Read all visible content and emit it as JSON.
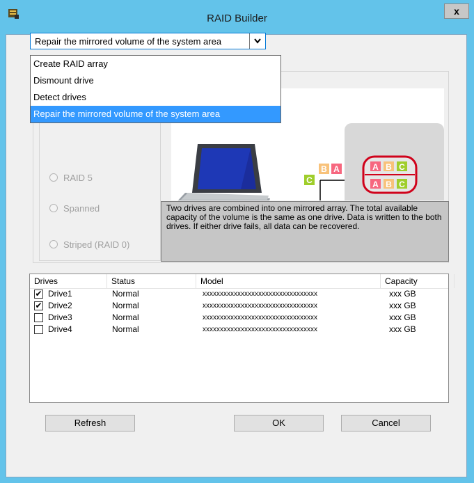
{
  "window": {
    "title": "RAID Builder",
    "close_label": "x",
    "icon": "raid-builder-app-icon"
  },
  "combo": {
    "selected": "Repair the mirrored volume of the system area",
    "options": [
      "Create RAID array",
      "Dismount drive",
      "Detect drives",
      "Repair the mirrored volume of the system area"
    ]
  },
  "raid_types": [
    "RAID 5",
    "Spanned",
    "Striped (RAID 0)"
  ],
  "illustration": {
    "blocks_left": [
      "B",
      "A",
      "C"
    ],
    "disk_blocks": [
      "A",
      "B",
      "C"
    ]
  },
  "description": "Two drives are combined into one mirrored array. The total available capacity of the volume is the same as one drive. Data is written to the both drives. If either drive fails, all data can be recovered.",
  "drives_table": {
    "headers": [
      "Drives",
      "Status",
      "Model",
      "Capacity"
    ],
    "rows": [
      {
        "checked": true,
        "name": "Drive1",
        "status": "Normal",
        "model": "xxxxxxxxxxxxxxxxxxxxxxxxxxxxxxxxx",
        "capacity": "xxx GB"
      },
      {
        "checked": true,
        "name": "Drive2",
        "status": "Normal",
        "model": "xxxxxxxxxxxxxxxxxxxxxxxxxxxxxxxxx",
        "capacity": "xxx GB"
      },
      {
        "checked": false,
        "name": "Drive3",
        "status": "Normal",
        "model": "xxxxxxxxxxxxxxxxxxxxxxxxxxxxxxxxx",
        "capacity": "xxx GB"
      },
      {
        "checked": false,
        "name": "Drive4",
        "status": "Normal",
        "model": "xxxxxxxxxxxxxxxxxxxxxxxxxxxxxxxxx",
        "capacity": "xxx GB"
      }
    ]
  },
  "buttons": {
    "refresh": "Refresh",
    "ok": "OK",
    "cancel": "Cancel"
  },
  "colors": {
    "title_bar": "#63c3ea",
    "selection": "#3399ff",
    "block_a": "#f7677f",
    "block_b": "#f8c27a",
    "block_c": "#9fce2b",
    "disk_ring": "#d0021b"
  }
}
